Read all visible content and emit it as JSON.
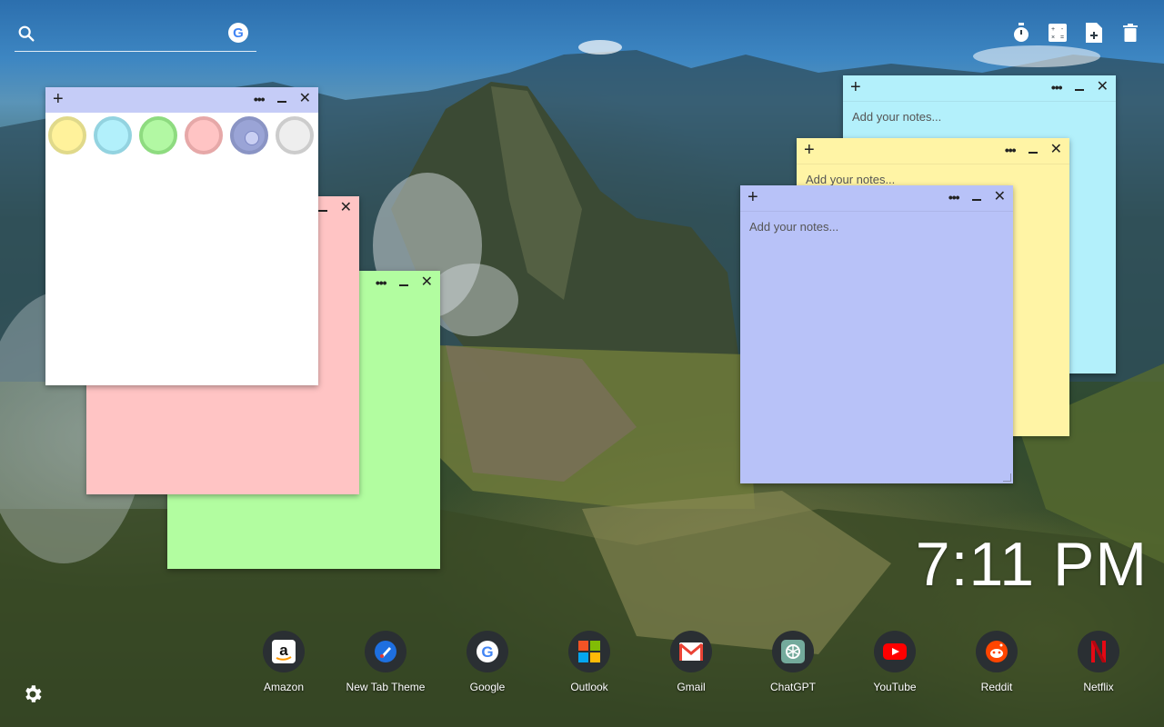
{
  "search": {
    "placeholder": ""
  },
  "notes": {
    "white": {
      "color": "#ffffff"
    },
    "pink": {
      "color": "#ffc4c4"
    },
    "green": {
      "color": "#b2fda0"
    },
    "cyan": {
      "color": "#b3f0fb",
      "placeholder": "Add your notes..."
    },
    "yellow": {
      "color": "#fff4a5",
      "placeholder": "Add your notes..."
    },
    "purple": {
      "color": "#b8c2f8",
      "placeholder": "Add your notes..."
    }
  },
  "swatches": [
    {
      "color": "#fff29b",
      "border": "#e0d98a"
    },
    {
      "color": "#b2f0fb",
      "border": "#93d3e0"
    },
    {
      "color": "#b2f8a3",
      "border": "#8edb80"
    },
    {
      "color": "#ffc4c4",
      "border": "#e6a8a8"
    },
    {
      "color": "#9aa4d6",
      "border": "#8a94c4"
    },
    {
      "color": "#eeeeee",
      "border": "#cccccc"
    }
  ],
  "clock": "7:11 PM",
  "dock": [
    {
      "label": "Amazon",
      "icon": "amazon-icon"
    },
    {
      "label": "New Tab Theme",
      "icon": "new-tab-theme-icon"
    },
    {
      "label": "Google",
      "icon": "google-icon"
    },
    {
      "label": "Outlook",
      "icon": "outlook-icon"
    },
    {
      "label": "Gmail",
      "icon": "gmail-icon"
    },
    {
      "label": "ChatGPT",
      "icon": "chatgpt-icon"
    },
    {
      "label": "YouTube",
      "icon": "youtube-icon"
    },
    {
      "label": "Reddit",
      "icon": "reddit-icon"
    },
    {
      "label": "Netflix",
      "icon": "netflix-icon"
    }
  ],
  "tools": [
    "timer-icon",
    "calculator-icon",
    "add-file-icon",
    "trash-icon"
  ]
}
